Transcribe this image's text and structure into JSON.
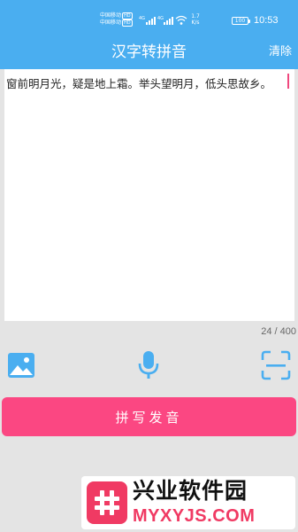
{
  "status_bar": {
    "carrier_1": "中国移动",
    "carrier_2": "中国移动",
    "hd_badge": "HD",
    "net_speed_value": "1.7",
    "net_speed_unit": "K/s",
    "battery_level": "100",
    "time": "10:53"
  },
  "header": {
    "title": "汉字转拼音",
    "clear_label": "清除"
  },
  "editor": {
    "text": "窗前明月光，疑是地上霜。举头望明月，低头思故乡。",
    "char_count": "24 / 400"
  },
  "toolbar": {
    "icons": [
      "image-icon",
      "microphone-icon",
      "scan-icon"
    ]
  },
  "action": {
    "label": "拼写发音"
  },
  "watermark": {
    "name": "兴业软件园",
    "domain": "MYXYJS.COM"
  },
  "colors": {
    "header_bg": "#4aaef0",
    "accent_pink": "#fb4782",
    "icon_blue": "#4aaef0",
    "page_bg": "#e4e4e4"
  }
}
